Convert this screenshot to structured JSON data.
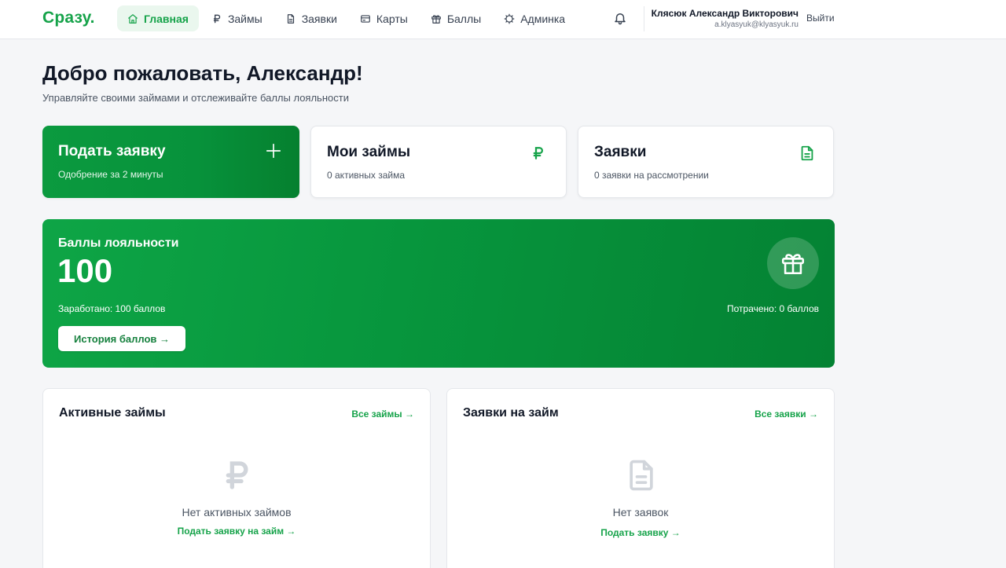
{
  "app": {
    "logo": "Сразу."
  },
  "nav": {
    "items": [
      {
        "label": "Главная",
        "icon": "home-icon",
        "active": true
      },
      {
        "label": "Займы",
        "icon": "ruble-icon"
      },
      {
        "label": "Заявки",
        "icon": "document-icon"
      },
      {
        "label": "Карты",
        "icon": "card-icon"
      },
      {
        "label": "Баллы",
        "icon": "gift-icon"
      },
      {
        "label": "Админка",
        "icon": "settings-icon"
      }
    ]
  },
  "user": {
    "name": "Клясюк Александр Викторович",
    "email": "a.klyasyuk@klyasyuk.ru",
    "logout": "Выйти"
  },
  "heading": {
    "title": "Добро пожаловать, Александр!",
    "subtitle": "Управляйте своими займами и отслеживайте баллы лояльности"
  },
  "cards": {
    "apply": {
      "title": "Подать заявку",
      "subtitle": "Одобрение за 2 минуты",
      "icon": "plus-icon"
    },
    "loans": {
      "title": "Мои займы",
      "subtitle": "0 активных займа",
      "icon": "ruble-icon"
    },
    "applications": {
      "title": "Заявки",
      "subtitle": "0 заявки на рассмотрении",
      "icon": "document-icon"
    }
  },
  "loyalty": {
    "label": "Баллы лояльности",
    "value": "100",
    "earned": "Заработано: 100 баллов",
    "spent": "Потрачено: 0 баллов",
    "history_button": "История баллов →",
    "icon": "gift-icon"
  },
  "panels": {
    "active_loans": {
      "title": "Активные займы",
      "link": "Все займы →",
      "empty_text": "Нет активных займов",
      "empty_link": "Подать заявку на займ →",
      "icon": "ruble-icon"
    },
    "loan_requests": {
      "title": "Заявки на займ",
      "link": "Все заявки →",
      "empty_text": "Нет заявок",
      "empty_link": "Подать заявку →",
      "icon": "document-icon"
    }
  },
  "colors": {
    "brand": "#16a34a",
    "brand_dark": "#048233",
    "nav_active_bg": "#eaf7ee",
    "page_bg": "#f5f6f8",
    "empty_icon": "#d1d5db"
  }
}
